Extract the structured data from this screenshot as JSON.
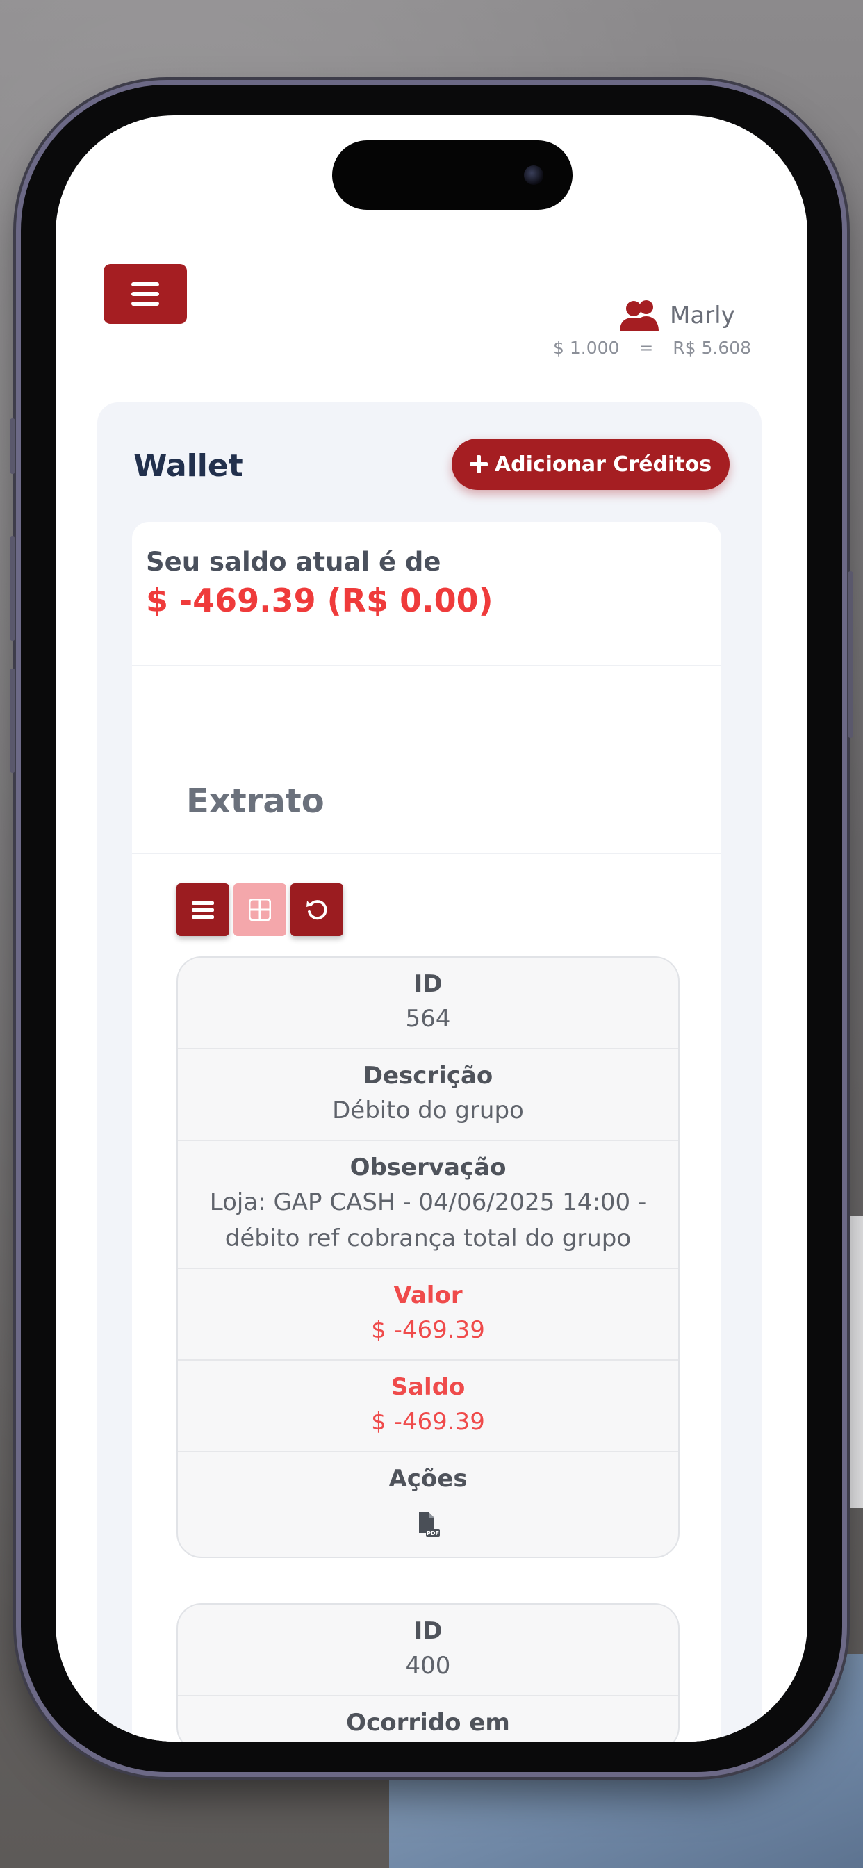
{
  "header": {
    "menu_icon": "hamburger-menu-icon",
    "user_icon": "users-icon",
    "user_name": "Marly",
    "rate_left": "$ 1.000",
    "rate_sep": "=",
    "rate_right": "R$ 5.608"
  },
  "wallet": {
    "title": "Wallet",
    "add_credits_label": "Adicionar Créditos",
    "add_credits_icon": "plus-icon",
    "balance_label": "Seu saldo atual é de",
    "balance_value": "$ -469.39 (R$ 0.00)"
  },
  "statement": {
    "title": "Extrato",
    "toolbar": [
      {
        "icon": "list-view-icon",
        "state": "active"
      },
      {
        "icon": "grid-view-icon",
        "state": "inactive"
      },
      {
        "icon": "refresh-icon",
        "state": "active"
      }
    ],
    "records": [
      {
        "id_label": "ID",
        "id": "564",
        "desc_label": "Descrição",
        "desc": "Débito do grupo",
        "obs_label": "Observação",
        "obs": "Loja: GAP CASH - 04/06/2025 14:00 - débito ref cobrança total do grupo",
        "valor_label": "Valor",
        "valor": "$ -469.39",
        "saldo_label": "Saldo",
        "saldo": "$ -469.39",
        "acoes_label": "Ações",
        "action_icon": "pdf-file-icon"
      },
      {
        "id_label": "ID",
        "id": "400",
        "ocorrido_label": "Ocorrido em"
      }
    ]
  },
  "colors": {
    "brand": "#a51e22",
    "negative": "#ef3b3b",
    "panel": "#f2f4f9"
  }
}
